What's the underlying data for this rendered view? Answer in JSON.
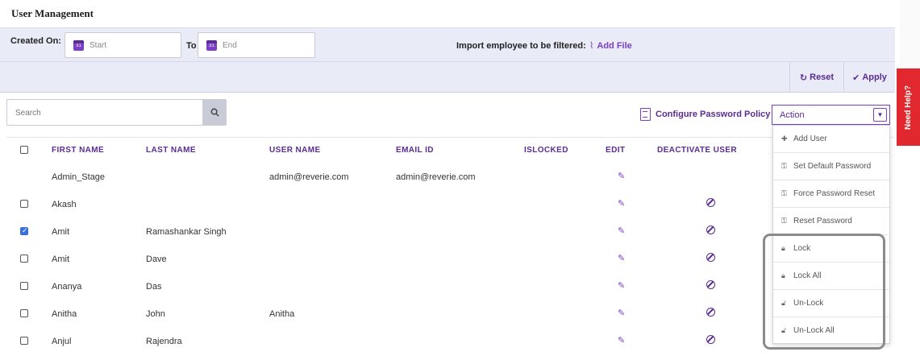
{
  "page": {
    "title": "User Management"
  },
  "filters": {
    "created_on_label": "Created On:",
    "start_placeholder": "Start",
    "to_label": "To",
    "end_placeholder": "End",
    "import_label": "Import employee to be filtered:",
    "add_file_label": "Add File",
    "reset_label": "Reset",
    "apply_label": "Apply"
  },
  "toolbar": {
    "search_placeholder": "Search",
    "configure_password_policy": "Configure Password Policy",
    "action_label": "Action"
  },
  "need_help": "Need Help?",
  "table": {
    "columns": [
      "FIRST NAME",
      "LAST NAME",
      "USER NAME",
      "EMAIL ID",
      "ISLOCKED",
      "EDIT",
      "DEACTIVATE USER"
    ],
    "rows": [
      {
        "checkbox": "none",
        "first_name": "Admin_Stage",
        "last_name": "",
        "user_name": "admin@reverie.com",
        "email": "admin@reverie.com",
        "edit": true,
        "deactivate": false
      },
      {
        "checkbox": "unchecked",
        "first_name": "Akash",
        "last_name": "",
        "user_name": "",
        "email": "",
        "edit": true,
        "deactivate": true
      },
      {
        "checkbox": "checked",
        "first_name": "Amit",
        "last_name": "Ramashankar Singh",
        "user_name": "",
        "email": "",
        "edit": true,
        "deactivate": true
      },
      {
        "checkbox": "unchecked",
        "first_name": "Amit",
        "last_name": "Dave",
        "user_name": "",
        "email": "",
        "edit": true,
        "deactivate": true
      },
      {
        "checkbox": "unchecked",
        "first_name": "Ananya",
        "last_name": "Das",
        "user_name": "",
        "email": "",
        "edit": true,
        "deactivate": true
      },
      {
        "checkbox": "unchecked",
        "first_name": "Anitha",
        "last_name": "John",
        "user_name": "Anitha",
        "email": "",
        "edit": true,
        "deactivate": true
      },
      {
        "checkbox": "unchecked",
        "first_name": "Anjul",
        "last_name": "Rajendra",
        "user_name": "",
        "email": "",
        "edit": true,
        "deactivate": true
      }
    ]
  },
  "action_menu": {
    "items": [
      {
        "label": "Add User",
        "icon": "plus-icon"
      },
      {
        "label": "Set Default Password",
        "icon": "key-icon"
      },
      {
        "label": "Force Password Reset",
        "icon": "key-icon"
      },
      {
        "label": "Reset Password",
        "icon": "key-icon"
      },
      {
        "label": "Lock",
        "icon": "lock-icon"
      },
      {
        "label": "Lock All",
        "icon": "lock-icon"
      },
      {
        "label": "Un-Lock",
        "icon": "unlock-icon"
      },
      {
        "label": "Un-Lock All",
        "icon": "unlock-icon"
      }
    ]
  },
  "colors": {
    "accent": "#7a3fc2",
    "accent_dark": "#5a2b95",
    "help": "#e0282e",
    "filter_bg": "#e9ebf7"
  }
}
